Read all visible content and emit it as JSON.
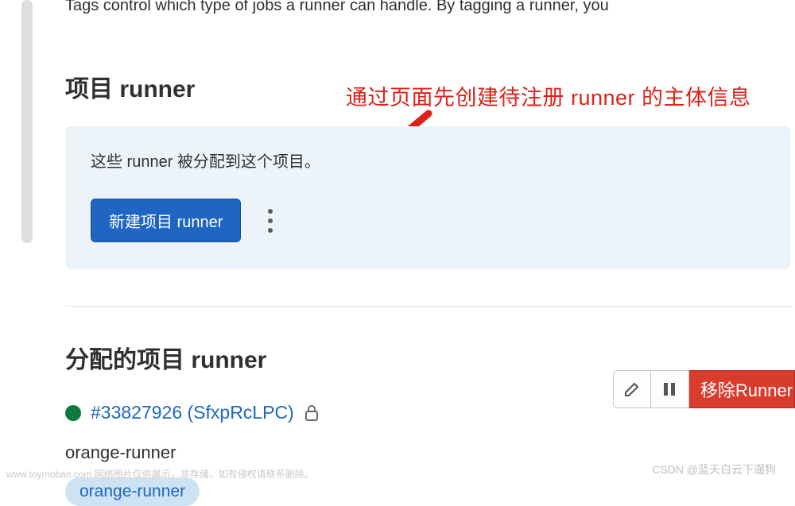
{
  "intro_text": "Tags control which type of jobs a runner can handle. By tagging a runner, you",
  "section1": {
    "title": "项目 runner",
    "annotation": "通过页面先创建待注册 runner 的主体信息",
    "panel_desc": "这些 runner 被分配到这个项目。",
    "create_btn": "新建项目 runner"
  },
  "section2": {
    "title": "分配的项目 runner",
    "runner": {
      "id": "#33827926",
      "short_sha": "(SfxpRcLPC)",
      "display": "#33827926 (SfxpRcLPC)",
      "status": "online",
      "name": "orange-runner",
      "tag": "orange-runner"
    },
    "remove_btn": "移除Runner"
  },
  "watermarks": {
    "left": "www.toymoban.com 网络图片仅供展示，非存储，如有侵权请联系删除。",
    "right": "CSDN @蓝天白云下遛狗"
  },
  "colors": {
    "primary": "#1e66c1",
    "danger": "#d93c2d",
    "panel_bg": "#ecf4fa",
    "status_online": "#0c7a3e",
    "annotation_red": "#dd2118"
  }
}
